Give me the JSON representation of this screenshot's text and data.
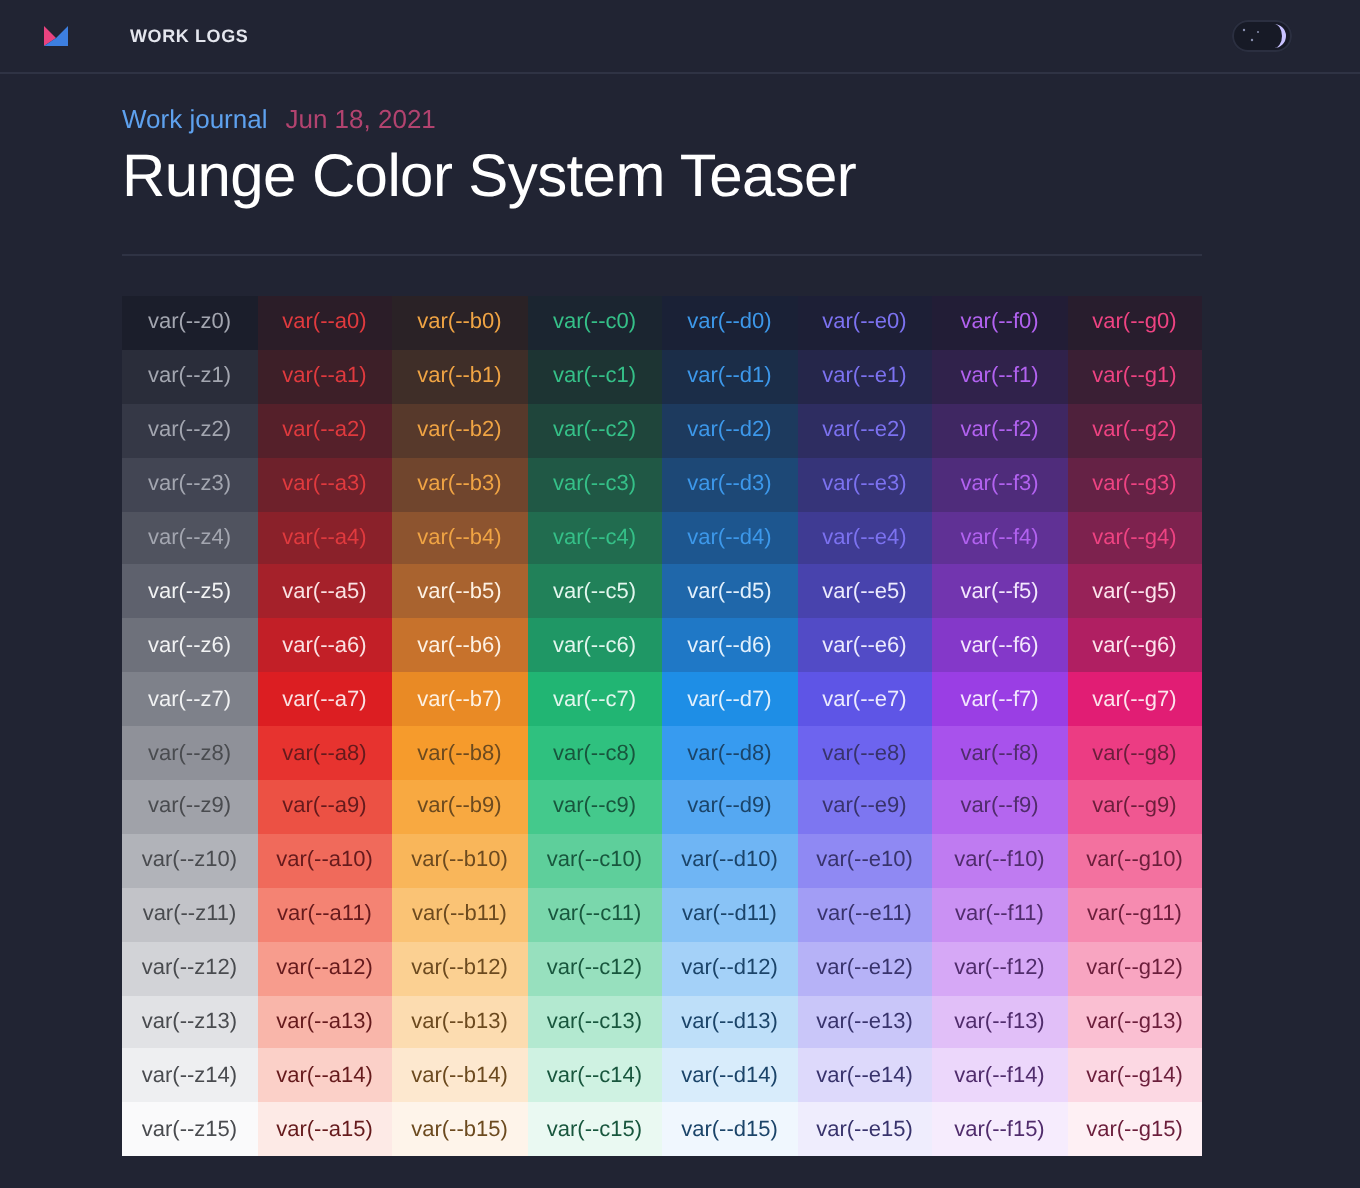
{
  "header": {
    "section": "WORK LOGS",
    "theme_toggle": {
      "on": true
    }
  },
  "article": {
    "category": "Work journal",
    "date": "Jun 18, 2021",
    "title": "Runge Color System Teaser"
  },
  "palette": {
    "columns": [
      {
        "color": "#a3a6b0",
        "cells": [
          {
            "label": "var(--z0)",
            "color": "#1b1e2b"
          },
          {
            "label": "var(--z1)",
            "color": "#2a2d3a"
          },
          {
            "label": "var(--z2)",
            "color": "#353846"
          },
          {
            "label": "var(--z3)",
            "color": "#424553"
          },
          {
            "label": "var(--z4)",
            "color": "#50535f"
          },
          {
            "label": "var(--z5)",
            "color": "#5e616d"
          },
          {
            "label": "var(--z6)",
            "color": "#6e717b"
          },
          {
            "label": "var(--z7)",
            "color": "#7e818a"
          },
          {
            "label": "var(--z8)",
            "color": "#8f9199"
          },
          {
            "label": "var(--z9)",
            "color": "#a0a2a9"
          },
          {
            "label": "var(--z10)",
            "color": "#b1b3b9"
          },
          {
            "label": "var(--z11)",
            "color": "#c2c3c8"
          },
          {
            "label": "var(--z12)",
            "color": "#d2d3d7"
          },
          {
            "label": "var(--z13)",
            "color": "#e1e2e5"
          },
          {
            "label": "var(--z14)",
            "color": "#eeeff1"
          },
          {
            "label": "var(--z15)",
            "color": "#fafafb"
          }
        ]
      },
      {
        "color": "#e03a3e",
        "cells": [
          {
            "label": "var(--a0)",
            "color": "#2b1d28"
          },
          {
            "label": "var(--a1)",
            "color": "#3d1f28"
          },
          {
            "label": "var(--a2)",
            "color": "#55202a"
          },
          {
            "label": "var(--a3)",
            "color": "#6e212b"
          },
          {
            "label": "var(--a4)",
            "color": "#8a212a"
          },
          {
            "label": "var(--a5)",
            "color": "#a5212a"
          },
          {
            "label": "var(--a6)",
            "color": "#c21f27"
          },
          {
            "label": "var(--a7)",
            "color": "#dc1e22"
          },
          {
            "label": "var(--a8)",
            "color": "#e7332f"
          },
          {
            "label": "var(--a9)",
            "color": "#ec5144"
          },
          {
            "label": "var(--a10)",
            "color": "#f06a5b"
          },
          {
            "label": "var(--a11)",
            "color": "#f48373"
          },
          {
            "label": "var(--a12)",
            "color": "#f79c8d"
          },
          {
            "label": "var(--a13)",
            "color": "#f9b6aa"
          },
          {
            "label": "var(--a14)",
            "color": "#fbd0c8"
          },
          {
            "label": "var(--a15)",
            "color": "#fdeae6"
          }
        ]
      },
      {
        "color": "#f0a444",
        "cells": [
          {
            "label": "var(--b0)",
            "color": "#2a2226"
          },
          {
            "label": "var(--b1)",
            "color": "#3f2e28"
          },
          {
            "label": "var(--b2)",
            "color": "#57392b"
          },
          {
            "label": "var(--b3)",
            "color": "#70452d"
          },
          {
            "label": "var(--b4)",
            "color": "#8d542f"
          },
          {
            "label": "var(--b5)",
            "color": "#a9632f"
          },
          {
            "label": "var(--b6)",
            "color": "#c7722c"
          },
          {
            "label": "var(--b7)",
            "color": "#e98a25"
          },
          {
            "label": "var(--b8)",
            "color": "#f69b2c"
          },
          {
            "label": "var(--b9)",
            "color": "#f8a941"
          },
          {
            "label": "var(--b10)",
            "color": "#f9b65a"
          },
          {
            "label": "var(--b11)",
            "color": "#fac375"
          },
          {
            "label": "var(--b12)",
            "color": "#fbd092"
          },
          {
            "label": "var(--b13)",
            "color": "#fcdcb0"
          },
          {
            "label": "var(--b14)",
            "color": "#fde8cf"
          },
          {
            "label": "var(--b15)",
            "color": "#fef4ea"
          }
        ]
      },
      {
        "color": "#35c088",
        "cells": [
          {
            "label": "var(--c0)",
            "color": "#1b2530"
          },
          {
            "label": "var(--c1)",
            "color": "#1d3433"
          },
          {
            "label": "var(--c2)",
            "color": "#1f453b"
          },
          {
            "label": "var(--c3)",
            "color": "#205845"
          },
          {
            "label": "var(--c4)",
            "color": "#216c4f"
          },
          {
            "label": "var(--c5)",
            "color": "#218159"
          },
          {
            "label": "var(--c6)",
            "color": "#1f9765"
          },
          {
            "label": "var(--c7)",
            "color": "#21b573"
          },
          {
            "label": "var(--c8)",
            "color": "#2fc17f"
          },
          {
            "label": "var(--c9)",
            "color": "#44c98c"
          },
          {
            "label": "var(--c10)",
            "color": "#5ecf9b"
          },
          {
            "label": "var(--c11)",
            "color": "#7ad7ac"
          },
          {
            "label": "var(--c12)",
            "color": "#97e0be"
          },
          {
            "label": "var(--c13)",
            "color": "#b3e9d0"
          },
          {
            "label": "var(--c14)",
            "color": "#cff2e2"
          },
          {
            "label": "var(--c15)",
            "color": "#eaf9f2"
          }
        ]
      },
      {
        "color": "#3d98ea",
        "cells": [
          {
            "label": "var(--d0)",
            "color": "#1a2136"
          },
          {
            "label": "var(--d1)",
            "color": "#1b2d48"
          },
          {
            "label": "var(--d2)",
            "color": "#1d3a5e"
          },
          {
            "label": "var(--d3)",
            "color": "#1d4876"
          },
          {
            "label": "var(--d4)",
            "color": "#1d568f"
          },
          {
            "label": "var(--d5)",
            "color": "#1f67aa"
          },
          {
            "label": "var(--d6)",
            "color": "#1f78c6"
          },
          {
            "label": "var(--d7)",
            "color": "#1e8ee6"
          },
          {
            "label": "var(--d8)",
            "color": "#379bf0"
          },
          {
            "label": "var(--d9)",
            "color": "#55a8f2"
          },
          {
            "label": "var(--d10)",
            "color": "#6fb5f4"
          },
          {
            "label": "var(--d11)",
            "color": "#89c3f6"
          },
          {
            "label": "var(--d12)",
            "color": "#a4d1f8"
          },
          {
            "label": "var(--d13)",
            "color": "#bedff9"
          },
          {
            "label": "var(--d14)",
            "color": "#d8ecfb"
          },
          {
            "label": "var(--d15)",
            "color": "#f0f7fe"
          }
        ]
      },
      {
        "color": "#7c72f0",
        "cells": [
          {
            "label": "var(--e0)",
            "color": "#1d1f36"
          },
          {
            "label": "var(--e1)",
            "color": "#25264a"
          },
          {
            "label": "var(--e2)",
            "color": "#2e2d61"
          },
          {
            "label": "var(--e3)",
            "color": "#363479"
          },
          {
            "label": "var(--e4)",
            "color": "#3f3b93"
          },
          {
            "label": "var(--e5)",
            "color": "#4843ad"
          },
          {
            "label": "var(--e6)",
            "color": "#524bc6"
          },
          {
            "label": "var(--e7)",
            "color": "#5e55e6"
          },
          {
            "label": "var(--e8)",
            "color": "#6d64ef"
          },
          {
            "label": "var(--e9)",
            "color": "#7d76f1"
          },
          {
            "label": "var(--e10)",
            "color": "#8f89f3"
          },
          {
            "label": "var(--e11)",
            "color": "#a29df5"
          },
          {
            "label": "var(--e12)",
            "color": "#b6b2f7"
          },
          {
            "label": "var(--e13)",
            "color": "#c9c6f9"
          },
          {
            "label": "var(--e14)",
            "color": "#ddd9fb"
          },
          {
            "label": "var(--e15)",
            "color": "#efedfd"
          }
        ]
      },
      {
        "color": "#b262f0",
        "cells": [
          {
            "label": "var(--f0)",
            "color": "#221d36"
          },
          {
            "label": "var(--f1)",
            "color": "#30224b"
          },
          {
            "label": "var(--f2)",
            "color": "#3f2762"
          },
          {
            "label": "var(--f3)",
            "color": "#4f2c7b"
          },
          {
            "label": "var(--f4)",
            "color": "#603195"
          },
          {
            "label": "var(--f5)",
            "color": "#7235af"
          },
          {
            "label": "var(--f6)",
            "color": "#8438c9"
          },
          {
            "label": "var(--f7)",
            "color": "#9a3ee4"
          },
          {
            "label": "var(--f8)",
            "color": "#a852ec"
          },
          {
            "label": "var(--f9)",
            "color": "#b466ef"
          },
          {
            "label": "var(--f10)",
            "color": "#bf7bf1"
          },
          {
            "label": "var(--f11)",
            "color": "#ca91f3"
          },
          {
            "label": "var(--f12)",
            "color": "#d6a8f6"
          },
          {
            "label": "var(--f13)",
            "color": "#e1bff8"
          },
          {
            "label": "var(--f14)",
            "color": "#ecd7fb"
          },
          {
            "label": "var(--f15)",
            "color": "#f6ecfd"
          }
        ]
      },
      {
        "color": "#ee4382",
        "cells": [
          {
            "label": "var(--g0)",
            "color": "#281d2d"
          },
          {
            "label": "var(--g1)",
            "color": "#3a1f34"
          },
          {
            "label": "var(--g2)",
            "color": "#4f213c"
          },
          {
            "label": "var(--g3)",
            "color": "#652245"
          },
          {
            "label": "var(--g4)",
            "color": "#7d224e"
          },
          {
            "label": "var(--g5)",
            "color": "#972258"
          },
          {
            "label": "var(--g6)",
            "color": "#b01f62"
          },
          {
            "label": "var(--g7)",
            "color": "#e11d74"
          },
          {
            "label": "var(--g8)",
            "color": "#ec3c83"
          },
          {
            "label": "var(--g9)",
            "color": "#f05791"
          },
          {
            "label": "var(--g10)",
            "color": "#f3719f"
          },
          {
            "label": "var(--g11)",
            "color": "#f68bb0"
          },
          {
            "label": "var(--g12)",
            "color": "#f8a5c1"
          },
          {
            "label": "var(--g13)",
            "color": "#fabfd2"
          },
          {
            "label": "var(--g14)",
            "color": "#fcd8e3"
          },
          {
            "label": "var(--g15)",
            "color": "#fef0f4"
          }
        ]
      }
    ]
  }
}
